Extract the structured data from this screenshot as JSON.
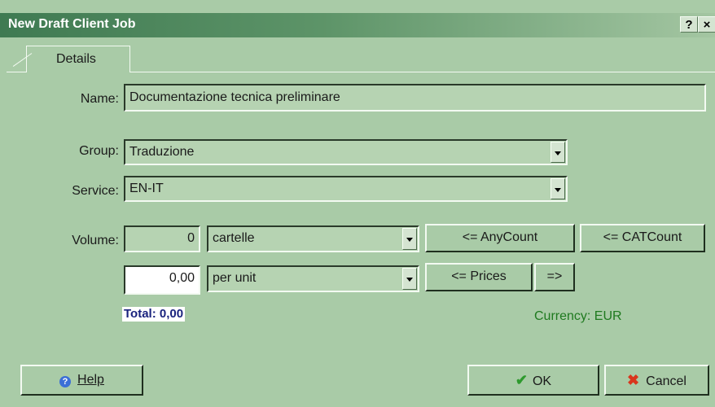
{
  "window": {
    "title": "New Draft Client Job",
    "help_button": "?",
    "close_button": "×"
  },
  "tabs": [
    {
      "label": "Details"
    }
  ],
  "form": {
    "name_label": "Name:",
    "name_value": "Documentazione tecnica preliminare",
    "group_label": "Group:",
    "group_value": "Traduzione",
    "service_label": "Service:",
    "service_value": "EN-IT",
    "volume_label": "Volume:",
    "volume_value": "0",
    "volume_unit": "cartelle",
    "price_value": "0,00",
    "price_unit": "per unit",
    "total": "Total: 0,00",
    "currency": "Currency: EUR"
  },
  "buttons": {
    "anycount": "<= AnyCount",
    "catcount": "<= CATCount",
    "prices": "<= Prices",
    "forward": "=>",
    "help": "Help",
    "ok": "OK",
    "cancel": "Cancel"
  }
}
